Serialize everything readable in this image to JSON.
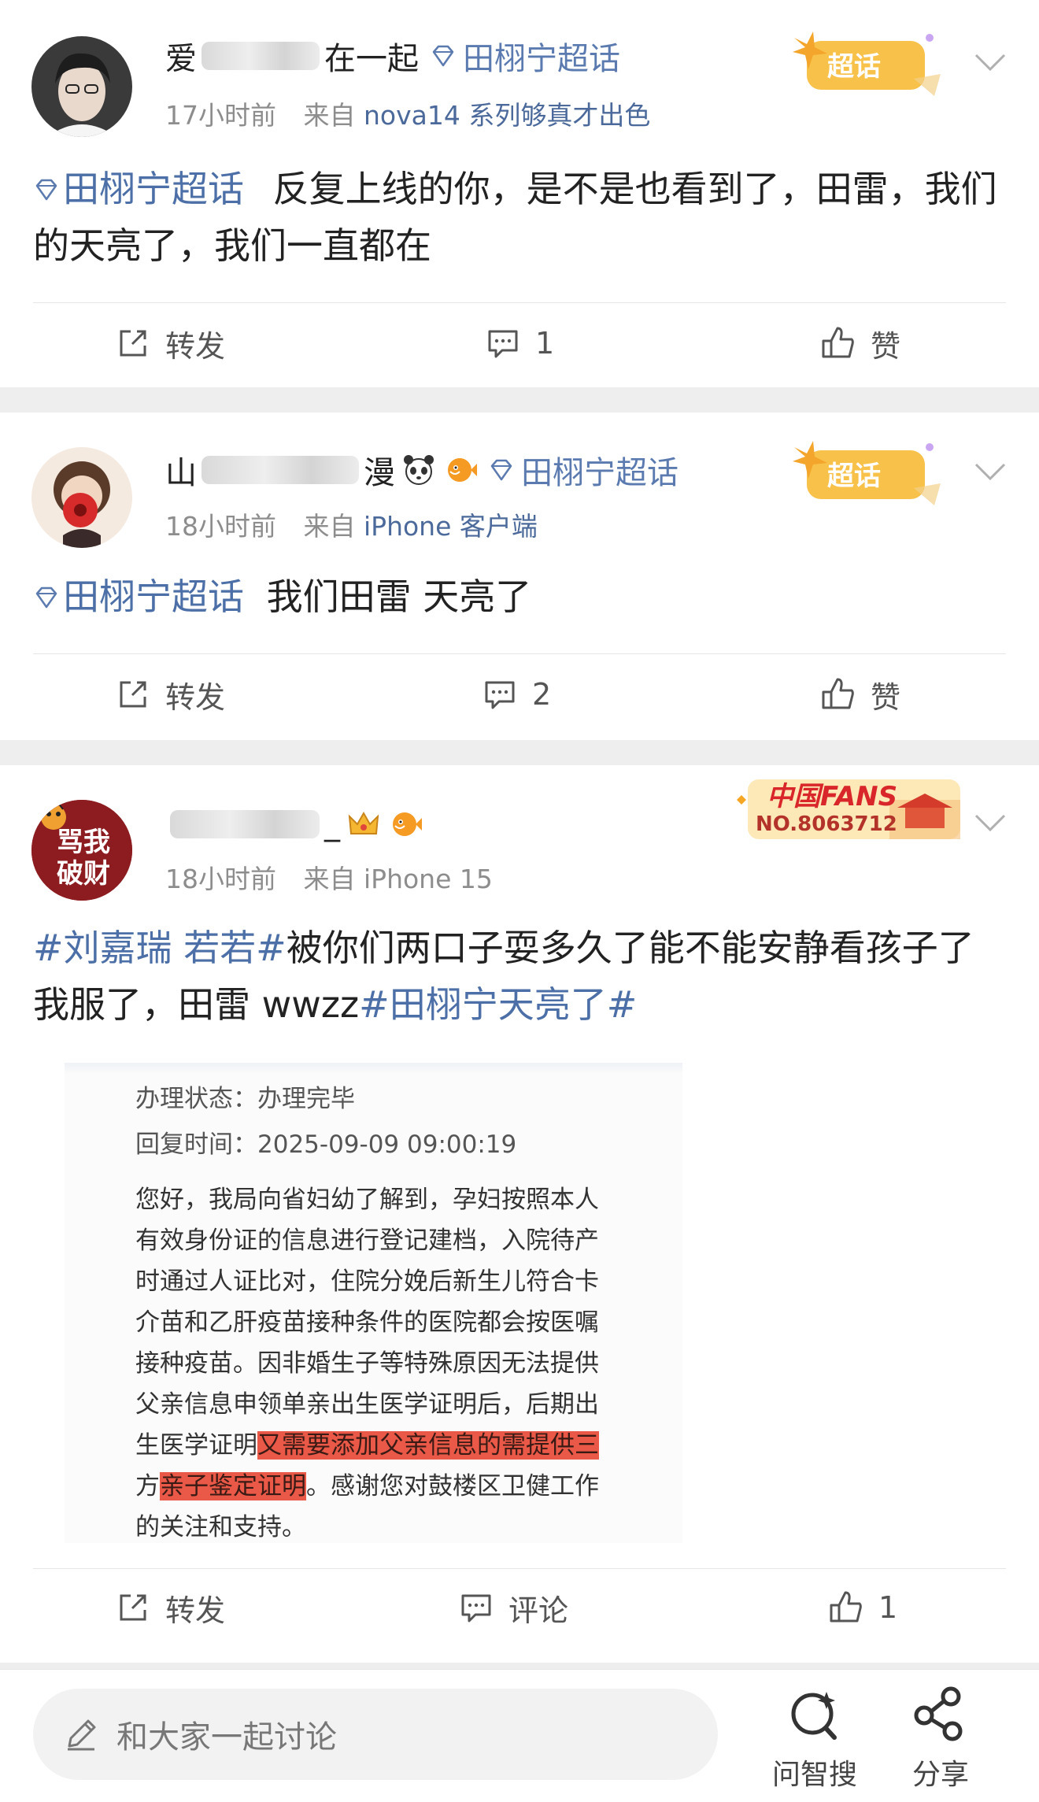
{
  "posts": [
    {
      "username_visible_start": "爱",
      "username_visible_end": "在一起",
      "topic": "田栩宁超话",
      "time": "17小时前",
      "source_prefix": "来自",
      "source": "nova14 系列够真才出色",
      "badge": "超话",
      "body_topic": "田栩宁超话",
      "body": "反复上线的你，是不是也看到了，田雷，我们的天亮了，我们一直都在",
      "actions": {
        "repost": "转发",
        "comment": "1",
        "like": "赞"
      }
    },
    {
      "username_visible_start": "山",
      "username_visible_end": "漫",
      "topic": "田栩宁超话",
      "time": "18小时前",
      "source_prefix": "来自",
      "source": "iPhone 客户端",
      "badge": "超话",
      "body_topic": "田栩宁超话",
      "body": "我们田雷 天亮了",
      "actions": {
        "repost": "转发",
        "comment": "2",
        "like": "赞"
      }
    },
    {
      "username_visible_start": "",
      "username_visible_end": "_",
      "avatar_text": "骂我破财",
      "time": "18小时前",
      "source_prefix": "来自",
      "source": "iPhone 15",
      "badge_title": "中国FANS",
      "badge_no": "NO.8063712",
      "body_tag1": "#刘嘉瑞 若若#",
      "body_mid": "被你们两口子耍多久了能不能安静看孩子了我服了，田雷 wwzz",
      "body_tag2": "#田栩宁天亮了#",
      "image_lines": {
        "status": "办理状态：办理完毕",
        "reply_time": "回复时间：2025-09-09 09:00:19",
        "l1": "您好，我局向省妇幼了解到，孕妇按照本人",
        "l2": "有效身份证的信息进行登记建档，入院待产",
        "l3": "时通过人证比对，住院分娩后新生儿符合卡",
        "l4": "介苗和乙肝疫苗接种条件的医院都会按医嘱",
        "l5": "接种疫苗。因非婚生子等特殊原因无法提供",
        "l6": "父亲信息申领单亲出生医学证明后，后期出",
        "l7a": "生医学证明",
        "l7b": "又需要添加父亲信息的需提供三",
        "l8a": "方",
        "l8b": "亲子鉴定证明",
        "l8c": "。感谢您对鼓楼区卫健工作",
        "l9": "的关注和支持。"
      },
      "actions": {
        "repost": "转发",
        "comment": "评论",
        "like": "1"
      }
    }
  ],
  "bottom_bar": {
    "placeholder": "和大家一起讨论",
    "ask": "问智搜",
    "share": "分享"
  },
  "colors": {
    "link": "#5b7bb0",
    "text": "#222222",
    "meta": "#8d8d8d",
    "highlight": "#e63c28"
  },
  "icons": [
    "gem-icon",
    "chevron-down-icon",
    "repost-icon",
    "comment-icon",
    "like-icon",
    "pencil-icon",
    "ai-search-icon",
    "share-icon"
  ]
}
